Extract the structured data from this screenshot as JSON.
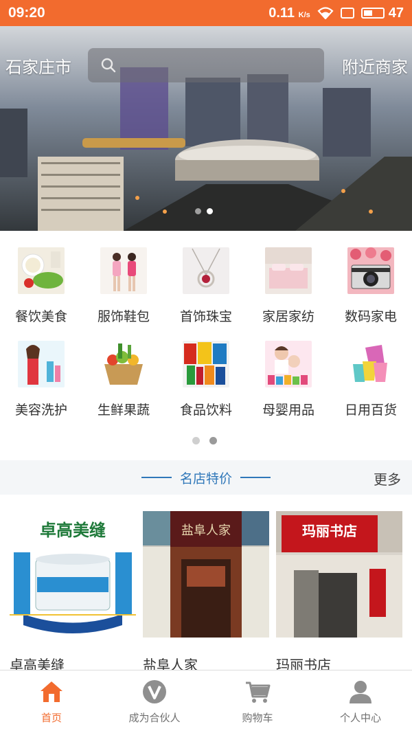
{
  "status_bar": {
    "time": "09:20",
    "speed": "0.11",
    "speed_unit": "K/s",
    "battery": "47",
    "battery_level": 0.47,
    "icons": [
      "wifi-icon",
      "sim-icon",
      "battery-icon"
    ]
  },
  "header": {
    "city": "石家庄市",
    "search_placeholder": "",
    "nearby": "附近商家",
    "search_icon": "search-icon"
  },
  "banner": {
    "dots_total": 2,
    "active_dot": 1
  },
  "categories": [
    {
      "label": "餐饮美食",
      "icon": "food-icon"
    },
    {
      "label": "服饰鞋包",
      "icon": "clothing-icon"
    },
    {
      "label": "首饰珠宝",
      "icon": "jewelry-icon"
    },
    {
      "label": "家居家纺",
      "icon": "home-textile-icon"
    },
    {
      "label": "数码家电",
      "icon": "camera-icon"
    },
    {
      "label": "美容洗护",
      "icon": "beauty-icon"
    },
    {
      "label": "生鲜果蔬",
      "icon": "produce-icon"
    },
    {
      "label": "食品饮料",
      "icon": "snacks-icon"
    },
    {
      "label": "母婴用品",
      "icon": "baby-icon"
    },
    {
      "label": "日用百货",
      "icon": "cups-icon"
    }
  ],
  "category_pages": {
    "total": 2,
    "active": 1
  },
  "featured": {
    "title": "名店特价",
    "more": "更多"
  },
  "shops": [
    {
      "name": "卓高美缝",
      "sign": "卓高美缝"
    },
    {
      "name": "盐阜人家",
      "sign": "盐阜人家"
    },
    {
      "name": "玛丽书店",
      "sign": "玛丽书店"
    }
  ],
  "nav": [
    {
      "label": "首页",
      "icon": "home-icon",
      "active": true
    },
    {
      "label": "成为合伙人",
      "icon": "partner-v-icon",
      "active": false
    },
    {
      "label": "购物车",
      "icon": "cart-icon",
      "active": false
    },
    {
      "label": "个人中心",
      "icon": "user-icon",
      "active": false
    }
  ],
  "colors": {
    "accent": "#f26b2e",
    "featured_blue": "#2f77b9",
    "nav_inactive": "#8a8a8a"
  }
}
